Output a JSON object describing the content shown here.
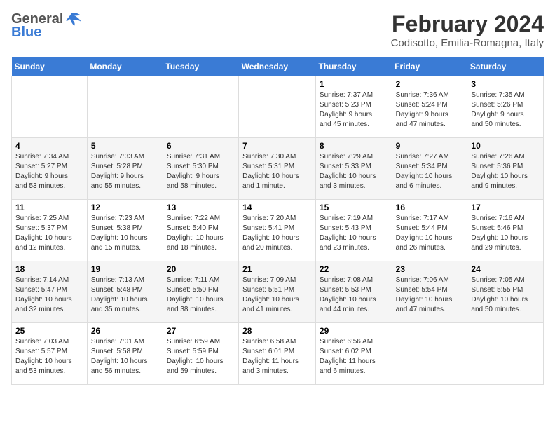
{
  "header": {
    "logo_general": "General",
    "logo_blue": "Blue",
    "month_title": "February 2024",
    "location": "Codisotto, Emilia-Romagna, Italy"
  },
  "days_of_week": [
    "Sunday",
    "Monday",
    "Tuesday",
    "Wednesday",
    "Thursday",
    "Friday",
    "Saturday"
  ],
  "weeks": [
    [
      {
        "day": "",
        "info": ""
      },
      {
        "day": "",
        "info": ""
      },
      {
        "day": "",
        "info": ""
      },
      {
        "day": "",
        "info": ""
      },
      {
        "day": "1",
        "info": "Sunrise: 7:37 AM\nSunset: 5:23 PM\nDaylight: 9 hours\nand 45 minutes."
      },
      {
        "day": "2",
        "info": "Sunrise: 7:36 AM\nSunset: 5:24 PM\nDaylight: 9 hours\nand 47 minutes."
      },
      {
        "day": "3",
        "info": "Sunrise: 7:35 AM\nSunset: 5:26 PM\nDaylight: 9 hours\nand 50 minutes."
      }
    ],
    [
      {
        "day": "4",
        "info": "Sunrise: 7:34 AM\nSunset: 5:27 PM\nDaylight: 9 hours\nand 53 minutes."
      },
      {
        "day": "5",
        "info": "Sunrise: 7:33 AM\nSunset: 5:28 PM\nDaylight: 9 hours\nand 55 minutes."
      },
      {
        "day": "6",
        "info": "Sunrise: 7:31 AM\nSunset: 5:30 PM\nDaylight: 9 hours\nand 58 minutes."
      },
      {
        "day": "7",
        "info": "Sunrise: 7:30 AM\nSunset: 5:31 PM\nDaylight: 10 hours\nand 1 minute."
      },
      {
        "day": "8",
        "info": "Sunrise: 7:29 AM\nSunset: 5:33 PM\nDaylight: 10 hours\nand 3 minutes."
      },
      {
        "day": "9",
        "info": "Sunrise: 7:27 AM\nSunset: 5:34 PM\nDaylight: 10 hours\nand 6 minutes."
      },
      {
        "day": "10",
        "info": "Sunrise: 7:26 AM\nSunset: 5:36 PM\nDaylight: 10 hours\nand 9 minutes."
      }
    ],
    [
      {
        "day": "11",
        "info": "Sunrise: 7:25 AM\nSunset: 5:37 PM\nDaylight: 10 hours\nand 12 minutes."
      },
      {
        "day": "12",
        "info": "Sunrise: 7:23 AM\nSunset: 5:38 PM\nDaylight: 10 hours\nand 15 minutes."
      },
      {
        "day": "13",
        "info": "Sunrise: 7:22 AM\nSunset: 5:40 PM\nDaylight: 10 hours\nand 18 minutes."
      },
      {
        "day": "14",
        "info": "Sunrise: 7:20 AM\nSunset: 5:41 PM\nDaylight: 10 hours\nand 20 minutes."
      },
      {
        "day": "15",
        "info": "Sunrise: 7:19 AM\nSunset: 5:43 PM\nDaylight: 10 hours\nand 23 minutes."
      },
      {
        "day": "16",
        "info": "Sunrise: 7:17 AM\nSunset: 5:44 PM\nDaylight: 10 hours\nand 26 minutes."
      },
      {
        "day": "17",
        "info": "Sunrise: 7:16 AM\nSunset: 5:46 PM\nDaylight: 10 hours\nand 29 minutes."
      }
    ],
    [
      {
        "day": "18",
        "info": "Sunrise: 7:14 AM\nSunset: 5:47 PM\nDaylight: 10 hours\nand 32 minutes."
      },
      {
        "day": "19",
        "info": "Sunrise: 7:13 AM\nSunset: 5:48 PM\nDaylight: 10 hours\nand 35 minutes."
      },
      {
        "day": "20",
        "info": "Sunrise: 7:11 AM\nSunset: 5:50 PM\nDaylight: 10 hours\nand 38 minutes."
      },
      {
        "day": "21",
        "info": "Sunrise: 7:09 AM\nSunset: 5:51 PM\nDaylight: 10 hours\nand 41 minutes."
      },
      {
        "day": "22",
        "info": "Sunrise: 7:08 AM\nSunset: 5:53 PM\nDaylight: 10 hours\nand 44 minutes."
      },
      {
        "day": "23",
        "info": "Sunrise: 7:06 AM\nSunset: 5:54 PM\nDaylight: 10 hours\nand 47 minutes."
      },
      {
        "day": "24",
        "info": "Sunrise: 7:05 AM\nSunset: 5:55 PM\nDaylight: 10 hours\nand 50 minutes."
      }
    ],
    [
      {
        "day": "25",
        "info": "Sunrise: 7:03 AM\nSunset: 5:57 PM\nDaylight: 10 hours\nand 53 minutes."
      },
      {
        "day": "26",
        "info": "Sunrise: 7:01 AM\nSunset: 5:58 PM\nDaylight: 10 hours\nand 56 minutes."
      },
      {
        "day": "27",
        "info": "Sunrise: 6:59 AM\nSunset: 5:59 PM\nDaylight: 10 hours\nand 59 minutes."
      },
      {
        "day": "28",
        "info": "Sunrise: 6:58 AM\nSunset: 6:01 PM\nDaylight: 11 hours\nand 3 minutes."
      },
      {
        "day": "29",
        "info": "Sunrise: 6:56 AM\nSunset: 6:02 PM\nDaylight: 11 hours\nand 6 minutes."
      },
      {
        "day": "",
        "info": ""
      },
      {
        "day": "",
        "info": ""
      }
    ]
  ]
}
